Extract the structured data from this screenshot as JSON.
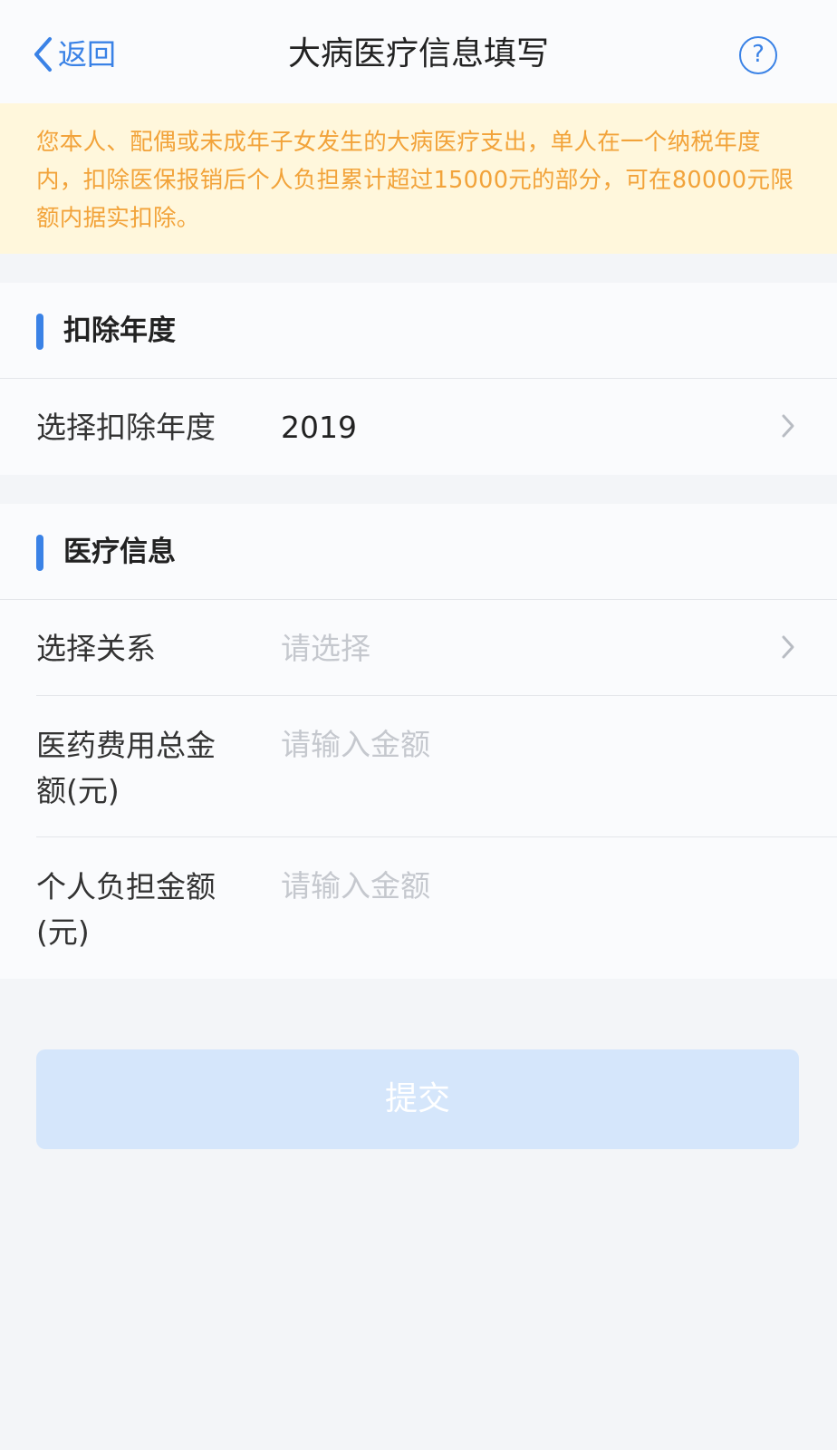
{
  "nav": {
    "back_label": "返回",
    "title": "大病医疗信息填写",
    "help_symbol": "?"
  },
  "notice": {
    "text": "您本人、配偶或未成年子女发生的大病医疗支出，单人在一个纳税年度内，扣除医保报销后个人负担累计超过15000元的部分，可在80000元限额内据实扣除。"
  },
  "deduction_section": {
    "title": "扣除年度",
    "year_row": {
      "label": "选择扣除年度",
      "value": "2019"
    }
  },
  "medical_section": {
    "title": "医疗信息",
    "relation_row": {
      "label": "选择关系",
      "placeholder": "请选择"
    },
    "total_row": {
      "label": "医药费用总金额(元)",
      "placeholder": "请输入金额"
    },
    "personal_row": {
      "label": "个人负担金额(元)",
      "placeholder": "请输入金额"
    }
  },
  "submit": {
    "label": "提交"
  },
  "colors": {
    "accent": "#3a82e6",
    "notice_text": "#f2a33a",
    "notice_bg": "#fff7dc",
    "submit_disabled_bg": "#d5e6fb"
  }
}
